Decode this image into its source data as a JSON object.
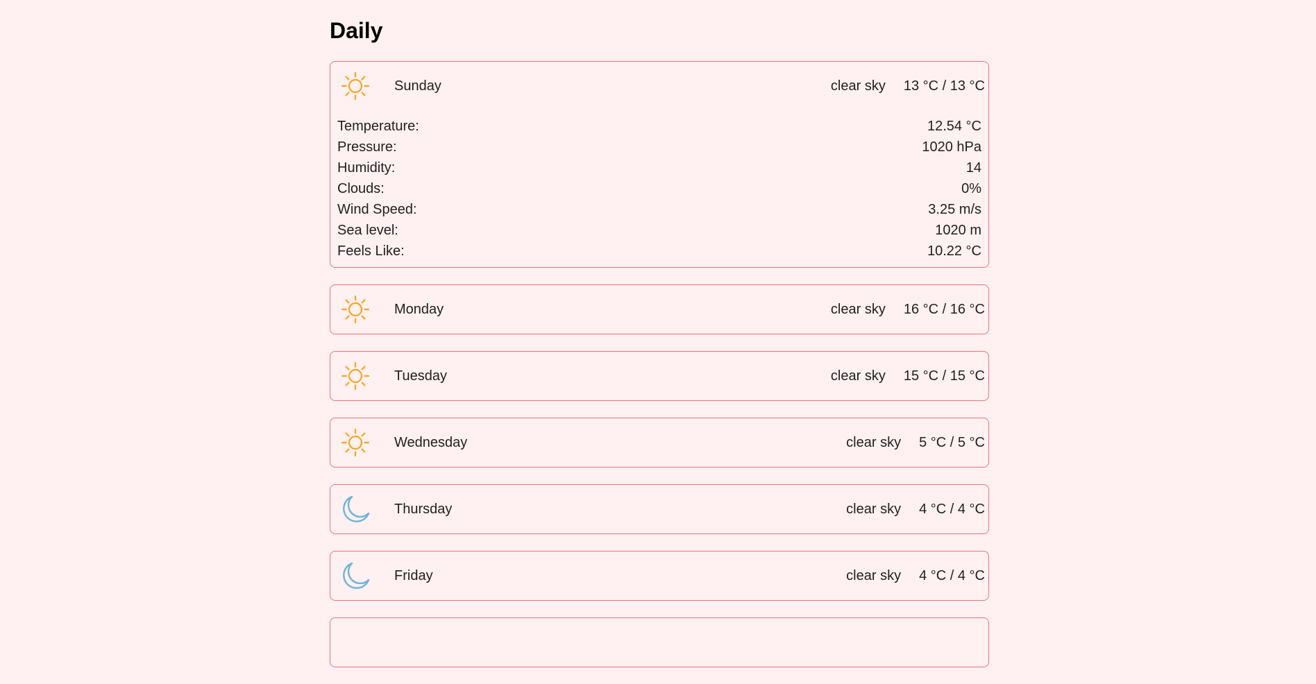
{
  "page": {
    "title": "Daily"
  },
  "colors": {
    "background": "#fff0f1",
    "card_border": "#e8737f",
    "sun_icon": "#f5a623",
    "moon_icon": "#6fb3d6"
  },
  "days": [
    {
      "name": "Sunday",
      "icon": "sun-icon",
      "description": "clear sky",
      "temp_range": "13 °C / 13 °C",
      "expanded": true,
      "details": [
        {
          "label": "Temperature:",
          "value": "12.54 °C"
        },
        {
          "label": "Pressure:",
          "value": "1020 hPa"
        },
        {
          "label": "Humidity:",
          "value": "14"
        },
        {
          "label": "Clouds:",
          "value": "0%"
        },
        {
          "label": "Wind Speed:",
          "value": "3.25 m/s"
        },
        {
          "label": "Sea level:",
          "value": "1020 m"
        },
        {
          "label": "Feels Like:",
          "value": "10.22 °C"
        }
      ]
    },
    {
      "name": "Monday",
      "icon": "sun-icon",
      "description": "clear sky",
      "temp_range": "16 °C / 16 °C",
      "expanded": false
    },
    {
      "name": "Tuesday",
      "icon": "sun-icon",
      "description": "clear sky",
      "temp_range": "15 °C / 15 °C",
      "expanded": false
    },
    {
      "name": "Wednesday",
      "icon": "sun-icon",
      "description": "clear sky",
      "temp_range": "5 °C / 5 °C",
      "expanded": false
    },
    {
      "name": "Thursday",
      "icon": "moon-icon",
      "description": "clear sky",
      "temp_range": "4 °C / 4 °C",
      "expanded": false
    },
    {
      "name": "Friday",
      "icon": "moon-icon",
      "description": "clear sky",
      "temp_range": "4 °C / 4 °C",
      "expanded": false
    },
    {
      "name": "",
      "icon": "",
      "description": "",
      "temp_range": "",
      "expanded": false
    }
  ]
}
